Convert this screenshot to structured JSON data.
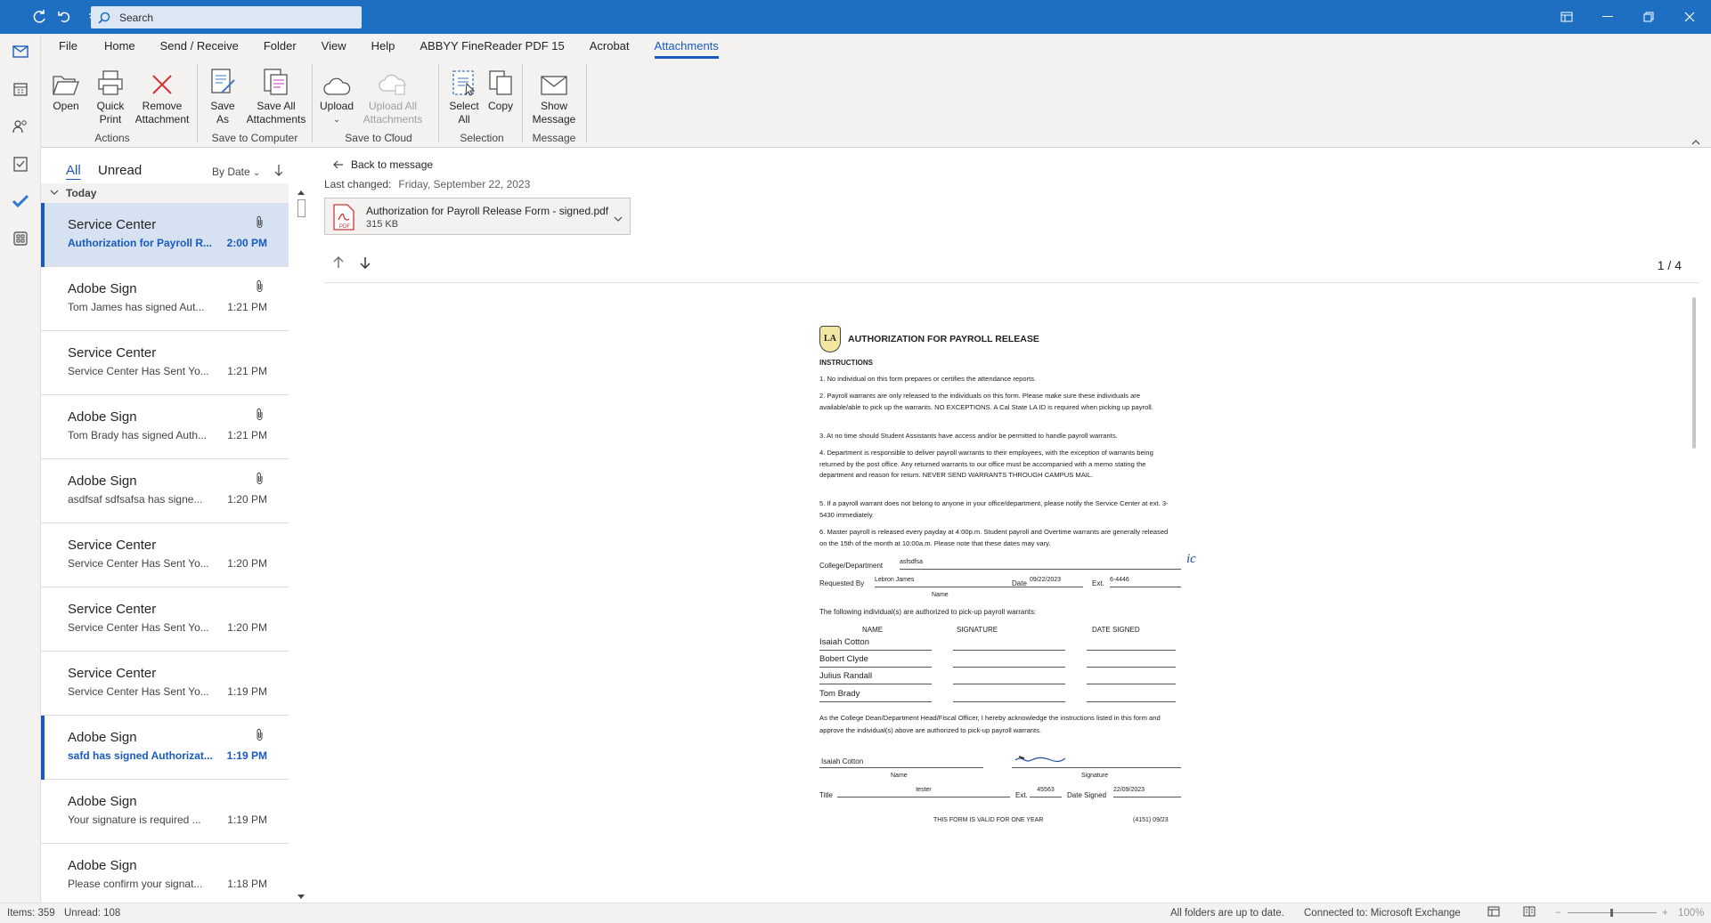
{
  "titlebar": {
    "search_placeholder": "Search"
  },
  "ribbon": {
    "tabs": [
      "File",
      "Home",
      "Send / Receive",
      "Folder",
      "View",
      "Help",
      "ABBYY FineReader PDF 15",
      "Acrobat",
      "Attachments"
    ],
    "active_tab": "Attachments",
    "buttons": {
      "open": "Open",
      "quick_print_1": "Quick",
      "quick_print_2": "Print",
      "remove_1": "Remove",
      "remove_2": "Attachment",
      "save_as_1": "Save",
      "save_as_2": "As",
      "save_all_1": "Save All",
      "save_all_2": "Attachments",
      "upload": "Upload",
      "upload_all_1": "Upload All",
      "upload_all_2": "Attachments",
      "select_all_1": "Select",
      "select_all_2": "All",
      "copy": "Copy",
      "show_msg_1": "Show",
      "show_msg_2": "Message"
    },
    "groups": {
      "actions": "Actions",
      "save_to_computer": "Save to Computer",
      "save_to_cloud": "Save to Cloud",
      "selection": "Selection",
      "message": "Message"
    }
  },
  "list": {
    "filter_all": "All",
    "filter_unread": "Unread",
    "sort": "By Date",
    "group": "Today",
    "items": [
      {
        "sender": "Service Center",
        "subject": "Authorization for Payroll R...",
        "time": "2:00 PM"
      },
      {
        "sender": "Adobe Sign",
        "subject": "Tom James has signed Aut...",
        "time": "1:21 PM"
      },
      {
        "sender": "Service Center",
        "subject": "Service Center Has Sent Yo...",
        "time": "1:21 PM"
      },
      {
        "sender": "Adobe Sign",
        "subject": "Tom Brady has signed Auth...",
        "time": "1:21 PM"
      },
      {
        "sender": "Adobe Sign",
        "subject": "asdfsaf sdfsafsa has signe...",
        "time": "1:20 PM"
      },
      {
        "sender": "Service Center",
        "subject": "Service Center Has Sent Yo...",
        "time": "1:20 PM"
      },
      {
        "sender": "Service Center",
        "subject": "Service Center Has Sent Yo...",
        "time": "1:20 PM"
      },
      {
        "sender": "Service Center",
        "subject": "Service Center Has Sent Yo...",
        "time": "1:19 PM"
      },
      {
        "sender": "Adobe Sign",
        "subject": "safd has signed Authorizat...",
        "time": "1:19 PM"
      },
      {
        "sender": "Adobe Sign",
        "subject": "Your signature is required ...",
        "time": "1:19 PM"
      },
      {
        "sender": "Adobe Sign",
        "subject": "Please confirm your signat...",
        "time": "1:18 PM"
      }
    ]
  },
  "reading": {
    "back": "Back to message",
    "last_changed_label": "Last changed:",
    "last_changed_value": "Friday, September 22, 2023",
    "attachment_name": "Authorization for Payroll Release Form  - signed.pdf",
    "attachment_size": "315 KB",
    "page_indicator": "1 / 4"
  },
  "doc": {
    "logo": "LA",
    "title": "AUTHORIZATION FOR PAYROLL RELEASE",
    "instructions": "INSTRUCTIONS",
    "p1": "1. No individual on this form prepares or certifies the attendance reports.",
    "p2": "2. Payroll warrants are only released to the individuals on this form. Please make sure these individuals are available/able to pick up the warrants. NO EXCEPTIONS. A Cal State LA ID is required when picking up payroll.",
    "p3": "3. At no time should Student Assistants have access and/or be permitted to handle payroll warrants.",
    "p4": "4. Department is responsible to deliver payroll warrants to their employees, with the exception of warrants being returned by the post office. Any returned warrants to our office must be accompanied with a memo stating the department and reason for return. NEVER SEND WARRANTS THROUGH CAMPUS MAIL.",
    "p5": "5. If a payroll warrant does not belong to anyone in your office/department, please notify the Service Center at ext. 3-5430 immediately.",
    "p6": "6. Master payroll is released every payday at 4:00p.m. Student payroll and Overtime warrants are generally released on the 15th of the month at 10:00a.m. Please note that these dates may vary.",
    "college_label": "College/Department",
    "college_value": "asfsdfsa",
    "initials": "ic",
    "requested_label": "Requested By",
    "requested_value": "Lebron James",
    "name_caption": "Name",
    "date_label": "Date",
    "date_value": "09/22/2023",
    "ext_label": "Ext.",
    "ext_value": "6-4446",
    "following": "The following individual(s) are authorized to pick-up payroll warrants:",
    "col_name": "NAME",
    "col_sig": "SIGNATURE",
    "col_date": "DATE SIGNED",
    "people": [
      "Isaiah Cotton",
      "Bobert Clyde",
      "Julius Randall",
      "Tom Brady"
    ],
    "ack": "As the College Dean/Department Head/Fiscal Officer, I hereby acknowledge the instructions listed in this form and approve the individual(s) above are authorized to pick-up payroll warrants.",
    "signer_name": "Isaiah Cotton",
    "signature_caption": "Signature",
    "title_label": "Title",
    "title_value": "tester",
    "ext2_label": "Ext.",
    "ext2_value": "45563",
    "date_signed_label": "Date Signed",
    "date_signed_value": "22/09/2023",
    "valid": "THIS FORM IS VALID FOR ONE YEAR",
    "form_no": "(4151) 09/23"
  },
  "status": {
    "items": "Items: 359",
    "unread": "Unread: 108",
    "sync": "All folders are up to date.",
    "connected": "Connected to: Microsoft Exchange",
    "zoom": "100%"
  }
}
